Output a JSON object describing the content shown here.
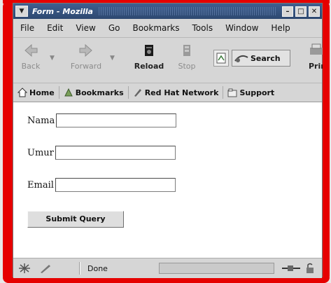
{
  "window": {
    "title": "Form - Mozilla"
  },
  "menubar": {
    "items": [
      {
        "label": "File"
      },
      {
        "label": "Edit"
      },
      {
        "label": "View"
      },
      {
        "label": "Go"
      },
      {
        "label": "Bookmarks"
      },
      {
        "label": "Tools"
      },
      {
        "label": "Window"
      },
      {
        "label": "Help"
      }
    ]
  },
  "nav": {
    "back": "Back",
    "forward": "Forward",
    "reload": "Reload",
    "stop": "Stop",
    "search": "Search",
    "print": "Print"
  },
  "personal": {
    "items": [
      {
        "label": "Home"
      },
      {
        "label": "Bookmarks"
      },
      {
        "label": "Red Hat Network"
      },
      {
        "label": "Support"
      }
    ]
  },
  "form": {
    "fields": [
      {
        "label": "Nama",
        "value": ""
      },
      {
        "label": "Umur",
        "value": ""
      },
      {
        "label": "Email",
        "value": ""
      }
    ],
    "submit_label": "Submit Query"
  },
  "status": {
    "text": "Done"
  },
  "colors": {
    "frame": "#e60000",
    "titlebar": "#2d4870",
    "chrome": "#d6d6d6"
  }
}
